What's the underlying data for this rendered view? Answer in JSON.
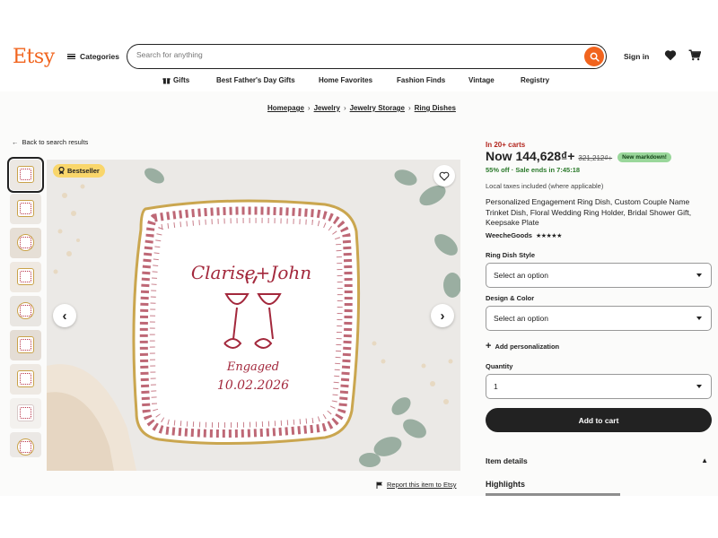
{
  "header": {
    "logo": "Etsy",
    "categories_label": "Categories",
    "search_placeholder": "Search for anything",
    "signin_label": "Sign in"
  },
  "nav": {
    "items": [
      "Gifts",
      "Best Father's Day Gifts",
      "Home Favorites",
      "Fashion Finds",
      "Vintage",
      "Registry"
    ]
  },
  "breadcrumb": [
    "Homepage",
    "Jewelry",
    "Jewelry Storage",
    "Ring Dishes"
  ],
  "back_label": "Back to search results",
  "gallery": {
    "bestseller_label": "Bestseller",
    "thumbnail_count": 9,
    "dish_names": "Clarise+John",
    "dish_caption": "Engaged",
    "dish_date": "10.02.2026",
    "report_label": "Report this item to Etsy"
  },
  "product": {
    "in_carts": "In 20+ carts",
    "price_now": "Now 144,628₫+",
    "price_old": "321,212₫+",
    "markdown_badge": "New markdown!",
    "sale_text": "55% off · Sale ends in 7:45:18",
    "taxes": "Local taxes included (where applicable)",
    "title": "Personalized Engagement Ring Dish, Custom Couple Name Trinket Dish, Floral Wedding Ring Holder, Bridal Shower Gift, Keepsake Plate",
    "shop_name": "WeecheGoods",
    "rating_stars": "★★★★★",
    "option1_label": "Ring Dish Style",
    "option1_value": "Select an option",
    "option2_label": "Design & Color",
    "option2_value": "Select an option",
    "add_personalization": "Add personalization",
    "quantity_label": "Quantity",
    "quantity_value": "1",
    "add_to_cart": "Add to cart",
    "item_details": "Item details",
    "highlights": "Highlights"
  },
  "colors": {
    "brand": "#f1641e",
    "sale_green": "#2b7a2b",
    "cart_red": "#b3261e",
    "dish_red": "#a3283c"
  }
}
